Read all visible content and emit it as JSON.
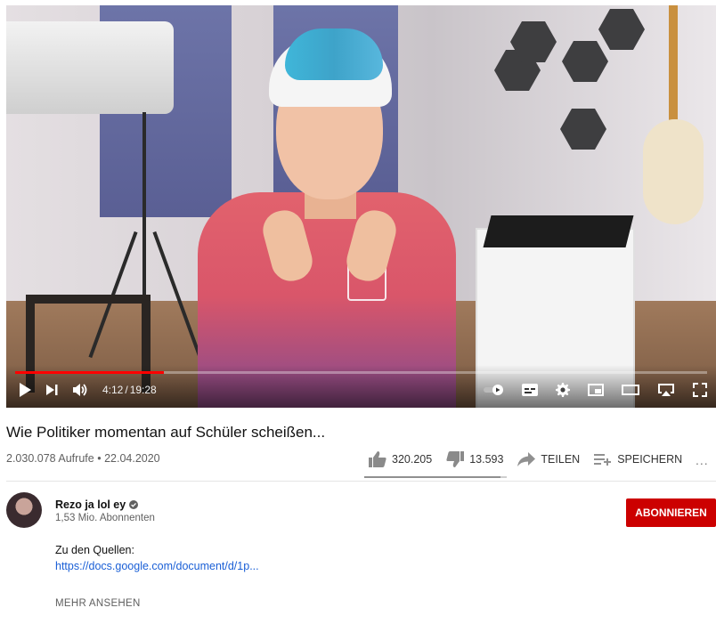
{
  "player": {
    "time_current": "4:12",
    "time_separator": "/",
    "time_total": "19:28",
    "progress_fraction": 0.215
  },
  "video": {
    "title": "Wie Politiker momentan auf Schüler scheißen...",
    "views": "2.030.078 Aufrufe",
    "dot": "•",
    "date": "22.04.2020"
  },
  "actions": {
    "likes": "320.205",
    "dislikes": "13.593",
    "share_label": "TEILEN",
    "save_label": "SPEICHERN",
    "more": "..."
  },
  "channel": {
    "name": "Rezo ja lol ey",
    "subscribers": "1,53 Mio. Abonnenten",
    "subscribe_label": "ABONNIEREN"
  },
  "description": {
    "line1": "Zu den Quellen:",
    "link": "https://docs.google.com/document/d/1p...",
    "show_more": "MEHR ANSEHEN"
  },
  "colors": {
    "accent_red": "#ff0000",
    "subscribe_red": "#cc0000",
    "link_blue": "#1a5fd6"
  },
  "icons": [
    "play-icon",
    "next-icon",
    "volume-icon",
    "autoplay-toggle-icon",
    "subtitles-icon",
    "settings-gear-icon",
    "miniplayer-icon",
    "theater-mode-icon",
    "airplay-icon",
    "fullscreen-icon",
    "thumbs-up-icon",
    "thumbs-down-icon",
    "share-arrow-icon",
    "save-playlist-icon",
    "verified-check-icon"
  ]
}
